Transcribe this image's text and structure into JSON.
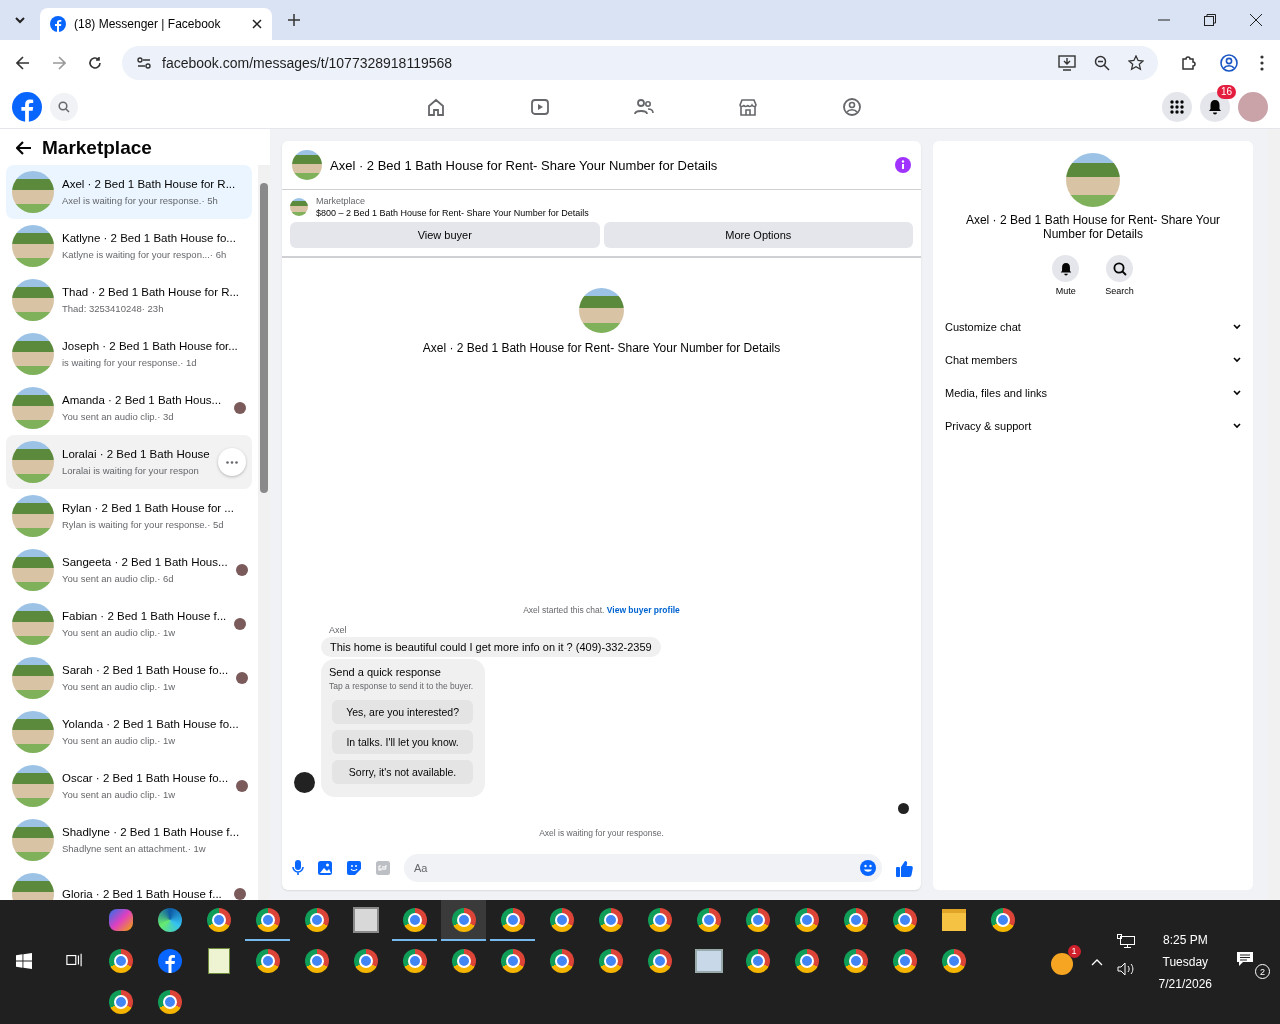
{
  "browser": {
    "tab": {
      "title": "(18) Messenger | Facebook"
    },
    "url": "facebook.com/messages/t/1077328918119568"
  },
  "fb_header": {
    "nav": [
      {
        "kind": "home"
      },
      {
        "kind": "video"
      },
      {
        "kind": "friends"
      },
      {
        "kind": "marketplace"
      },
      {
        "kind": "gaming"
      }
    ],
    "notification_badge": "16"
  },
  "sidebar": {
    "title": "Marketplace",
    "conversations": [
      {
        "name": "Axel · 2 Bed 1 Bath House for R...",
        "preview": "Axel is waiting for your response.",
        "time": "· 5h",
        "selected": true,
        "hovered": false,
        "seen": false
      },
      {
        "name": "Katlyne · 2 Bed 1 Bath House fo...",
        "preview": "Katlyne is waiting for your respon...",
        "time": "· 6h",
        "selected": false,
        "hovered": false,
        "seen": false
      },
      {
        "name": "Thad · 2 Bed 1 Bath House for R...",
        "preview": "Thad: 3253410248",
        "time": "· 23h",
        "selected": false,
        "hovered": false,
        "seen": false
      },
      {
        "name": "Joseph · 2 Bed 1 Bath House for...",
        "preview": "is waiting for your response.",
        "time": "· 1d",
        "selected": false,
        "hovered": false,
        "seen": false
      },
      {
        "name": "Amanda · 2 Bed 1 Bath Hous...",
        "preview": "You sent an audio clip.",
        "time": "· 3d",
        "selected": false,
        "hovered": false,
        "seen": true
      },
      {
        "name": "Loralai · 2 Bed 1 Bath House",
        "preview": "Loralai is waiting for your respon",
        "selected": false,
        "hovered": true,
        "seen": false
      },
      {
        "name": "Rylan · 2 Bed 1 Bath House for ...",
        "preview": "Rylan is waiting for your response.",
        "time": "· 5d",
        "selected": false,
        "hovered": false,
        "seen": false
      },
      {
        "name": "Sangeeta · 2 Bed 1 Bath Hous...",
        "preview": "You sent an audio clip.",
        "time": "· 6d",
        "selected": false,
        "hovered": false,
        "seen": true
      },
      {
        "name": "Fabian · 2 Bed 1 Bath House f...",
        "preview": "You sent an audio clip.",
        "time": "· 1w",
        "selected": false,
        "hovered": false,
        "seen": true
      },
      {
        "name": "Sarah · 2 Bed 1 Bath House fo...",
        "preview": "You sent an audio clip.",
        "time": "· 1w",
        "selected": false,
        "hovered": false,
        "seen": true
      },
      {
        "name": "Yolanda · 2 Bed 1 Bath House fo...",
        "preview": "You sent an audio clip.",
        "time": "· 1w",
        "selected": false,
        "hovered": false,
        "seen": false
      },
      {
        "name": "Oscar · 2 Bed 1 Bath House fo...",
        "preview": "You sent an audio clip.",
        "time": "· 1w",
        "selected": false,
        "hovered": false,
        "seen": true
      },
      {
        "name": "Shadlyne · 2 Bed 1 Bath House f...",
        "preview": "Shadlyne sent an attachment.",
        "time": "· 1w",
        "selected": false,
        "hovered": false,
        "seen": false
      },
      {
        "name": "Gloria · 2 Bed 1 Bath House f...",
        "selected": false,
        "hovered": false,
        "seen": true
      }
    ]
  },
  "chat": {
    "title": "Axel · 2 Bed 1 Bath House for Rent- Share Your Number for Details",
    "listing": {
      "source": "Marketplace",
      "summary": "$800 – 2 Bed 1 Bath House for Rent- Share Your Number for Details",
      "buttons": [
        "View buyer",
        "More Options"
      ]
    },
    "intro_title": "Axel · 2 Bed 1 Bath House for Rent- Share Your Number for Details",
    "started_text": "Axel started this chat.",
    "started_link": "View buyer profile",
    "sender": "Axel",
    "message": "This home is beautiful could I get more info on it ? (409)-332-2359",
    "quick": {
      "title": "Send a quick response",
      "hint": "Tap a response to send it to the buyer.",
      "responses": [
        "Yes, are you interested?",
        "In talks. I'll let you know.",
        "Sorry, it's not available."
      ]
    },
    "status": "Axel is waiting for your response.",
    "composer": {
      "placeholder": "Aa"
    }
  },
  "details": {
    "title": "Axel · 2 Bed 1 Bath House for Rent- Share Your Number for Details",
    "actions": [
      {
        "kind": "mute",
        "label": "Mute"
      },
      {
        "kind": "search",
        "label": "Search"
      }
    ],
    "sections": [
      {
        "label": "Customize chat",
        "expanded": false
      },
      {
        "label": "Chat members",
        "expanded": false
      },
      {
        "label": "Media, files and links",
        "expanded": false
      },
      {
        "label": "Privacy & support",
        "expanded": false
      }
    ]
  },
  "taskbar": {
    "rows": [
      [
        {
          "kind": "copilot",
          "running": false,
          "focused": false
        },
        {
          "kind": "edge",
          "running": false,
          "focused": false
        },
        {
          "kind": "chrome",
          "running": false,
          "focused": false
        },
        {
          "kind": "chrome",
          "running": true,
          "focused": false
        },
        {
          "kind": "chrome",
          "running": false,
          "focused": false
        },
        {
          "kind": "idcard",
          "running": false,
          "focused": false
        },
        {
          "kind": "chrome",
          "running": true,
          "focused": false
        },
        {
          "kind": "chrome",
          "running": true,
          "focused": true
        },
        {
          "kind": "chrome",
          "running": true,
          "focused": false
        },
        {
          "kind": "chrome",
          "running": false,
          "focused": false
        },
        {
          "kind": "chrome",
          "running": false,
          "focused": false
        },
        {
          "kind": "chrome",
          "running": false,
          "focused": false
        },
        {
          "kind": "chrome",
          "running": false,
          "focused": false
        },
        {
          "kind": "chrome",
          "running": false,
          "focused": false
        },
        {
          "kind": "chrome",
          "running": false,
          "focused": false
        },
        {
          "kind": "chrome",
          "running": false,
          "focused": false
        },
        {
          "kind": "chrome",
          "running": false,
          "focused": false
        },
        {
          "kind": "folder",
          "running": false,
          "focused": false
        },
        {
          "kind": "chrome",
          "running": false,
          "focused": false
        }
      ],
      [
        {
          "kind": "chrome",
          "running": false,
          "focused": false
        },
        {
          "kind": "facebook",
          "running": false,
          "focused": false
        },
        {
          "kind": "notepad",
          "running": false,
          "focused": false
        },
        {
          "kind": "chrome",
          "running": false,
          "focused": false
        },
        {
          "kind": "chrome",
          "running": false,
          "focused": false
        },
        {
          "kind": "chrome",
          "running": false,
          "focused": false
        },
        {
          "kind": "chrome",
          "running": false,
          "focused": false
        },
        {
          "kind": "chrome",
          "running": false,
          "focused": false
        },
        {
          "kind": "chrome",
          "running": false,
          "focused": false
        },
        {
          "kind": "chrome",
          "running": false,
          "focused": false
        },
        {
          "kind": "chrome",
          "running": false,
          "focused": false
        },
        {
          "kind": "chrome",
          "running": false,
          "focused": false
        },
        {
          "kind": "photos",
          "running": false,
          "focused": false
        },
        {
          "kind": "chrome",
          "running": false,
          "focused": false
        },
        {
          "kind": "chrome",
          "running": false,
          "focused": false
        },
        {
          "kind": "chrome",
          "running": false,
          "focused": false
        },
        {
          "kind": "chrome",
          "running": false,
          "focused": false
        },
        {
          "kind": "chrome",
          "running": false,
          "focused": false
        }
      ],
      [
        {
          "kind": "chrome",
          "running": false,
          "focused": false
        },
        {
          "kind": "chrome",
          "running": false,
          "focused": false
        }
      ]
    ],
    "tray_badge": "1",
    "clock": {
      "time": "8:25 PM",
      "day": "Tuesday",
      "date": "7/21/2026"
    },
    "notification_count": "2"
  }
}
